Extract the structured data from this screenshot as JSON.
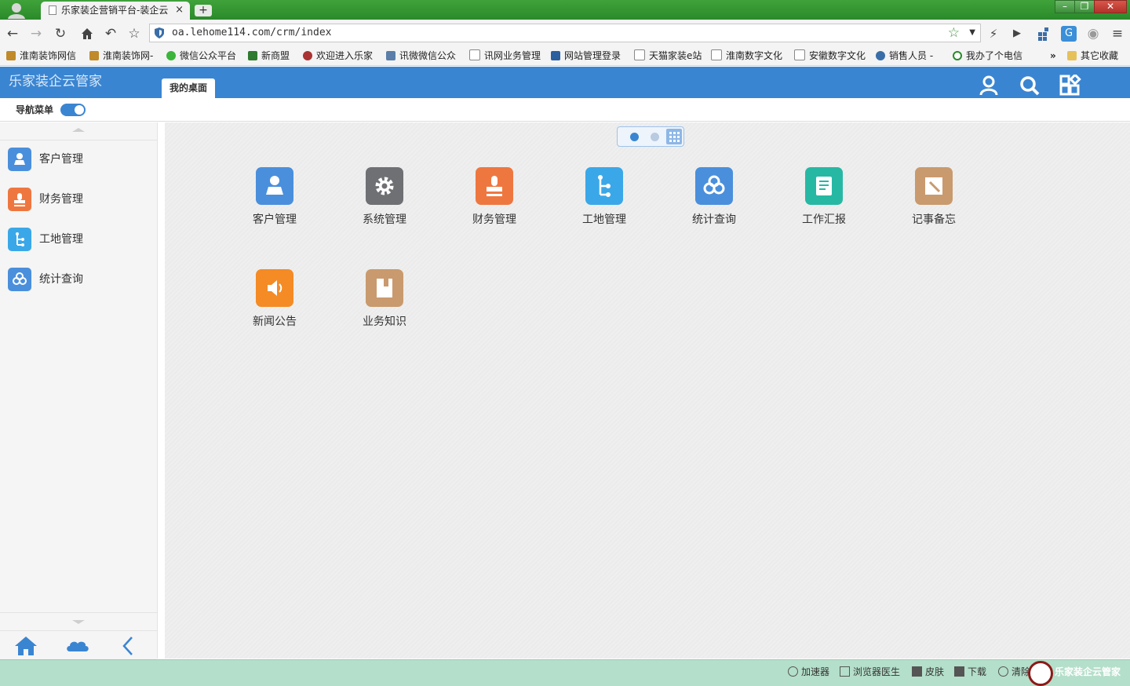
{
  "browser": {
    "tab_title": "乐家装企营销平台-装企云",
    "tab_close": "×",
    "new_tab": "+",
    "window_buttons": [
      "–",
      "❐",
      "✕"
    ],
    "url": "oa.lehome114.com/crm/index",
    "bookmarks": [
      "淮南装饰网信",
      "淮南装饰网-",
      "微信公众平台",
      "新商盟",
      "欢迎进入乐家",
      "讯微微信公众",
      "讯网业务管理",
      "网站管理登录",
      "天猫家装e站",
      "淮南数字文化",
      "安徽数字文化",
      "销售人员 -",
      "我办了个电信"
    ],
    "bookmarks_more": "»",
    "other_bookmarks": "其它收藏"
  },
  "app": {
    "title": "乐家装企云管家",
    "active_tab": "我的桌面",
    "nav_toggle_label": "导航菜单",
    "nav_toggle_on": true,
    "accent_color": "#3a85d2"
  },
  "sidebar": {
    "items": [
      {
        "label": "客户管理",
        "icon": "user-icon",
        "color": "#4a8fdc"
      },
      {
        "label": "财务管理",
        "icon": "stamp-icon",
        "color": "#ee7740"
      },
      {
        "label": "工地管理",
        "icon": "tree-icon",
        "color": "#3aa8e8"
      },
      {
        "label": "统计查询",
        "icon": "cloud-icon",
        "color": "#4a8fdc"
      }
    ],
    "bottom_buttons": [
      "home-icon",
      "cloud-icon",
      "collapse-icon"
    ]
  },
  "desktop": {
    "page_count": 2,
    "current_page": 1,
    "apps": [
      {
        "label": "客户管理",
        "icon": "user-icon",
        "color": "#4a8fdc"
      },
      {
        "label": "系统管理",
        "icon": "gear-icon",
        "color": "#6e7074"
      },
      {
        "label": "财务管理",
        "icon": "stamp-icon",
        "color": "#ee7740"
      },
      {
        "label": "工地管理",
        "icon": "tree-icon",
        "color": "#3aa8e8"
      },
      {
        "label": "统计查询",
        "icon": "cloud-icon",
        "color": "#4a8fdc"
      },
      {
        "label": "工作汇报",
        "icon": "report-icon",
        "color": "#27b8a4"
      },
      {
        "label": "记事备忘",
        "icon": "memo-icon",
        "color": "#c99a6e"
      },
      {
        "label": "新闻公告",
        "icon": "speaker-icon",
        "color": "#f48b25"
      },
      {
        "label": "业务知识",
        "icon": "book-icon",
        "color": "#c99a6e"
      }
    ]
  },
  "statusbar": {
    "items": [
      "加速器",
      "浏览器医生",
      "皮肤",
      "下载",
      "清除"
    ],
    "watermark": "乐家装企云管家"
  }
}
